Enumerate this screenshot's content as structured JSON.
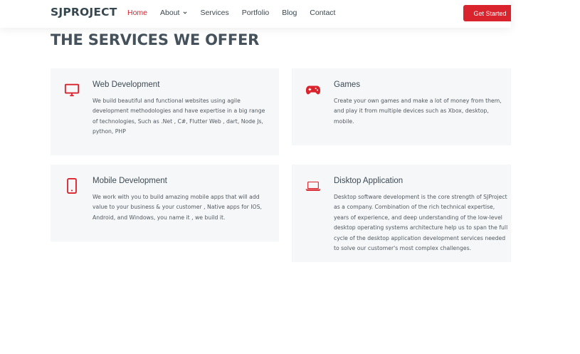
{
  "header": {
    "logo": "SJPROJECT",
    "nav": [
      {
        "label": "Home",
        "active": true
      },
      {
        "label": "About",
        "dropdown": true
      },
      {
        "label": "Services"
      },
      {
        "label": "Portfolio"
      },
      {
        "label": "Blog"
      },
      {
        "label": "Contact"
      }
    ],
    "cta_label": "Get Started"
  },
  "section": {
    "title": "THE SERVICES WE OFFER"
  },
  "services": [
    {
      "icon": "monitor-icon",
      "title": "Web Development",
      "description": "We build beautiful and functional websites using agile development methodologies and have expertise in a big range of technologies, Such as .Net , C#, Flutter Web , dart, Node Js, python, PHP"
    },
    {
      "icon": "gamepad-icon",
      "title": "Games",
      "description": "Create your own games and make a lot of money from them, and play it from multiple devices such as Xbox, desktop, mobile."
    },
    {
      "icon": "smartphone-icon",
      "title": "Mobile Development",
      "description": "We work with you to build amazing mobile apps that will add value to your business & your customer , Native apps for IOS, Android, and Windows, you name it , we build it."
    },
    {
      "icon": "laptop-icon",
      "title": "Disktop Application",
      "description": "Desktop software development is the core strength of SJProject as a company. Combination of the rich technical expertise, years of experience, and deep understanding of the low-level desktop operating systems architecture help us to span the full cycle of the desktop application development services needed to solve our customer's most complex challenges."
    }
  ],
  "colors": {
    "accent": "#d9232d",
    "heading": "#45525c",
    "card_bg": "#f6f7f9"
  }
}
